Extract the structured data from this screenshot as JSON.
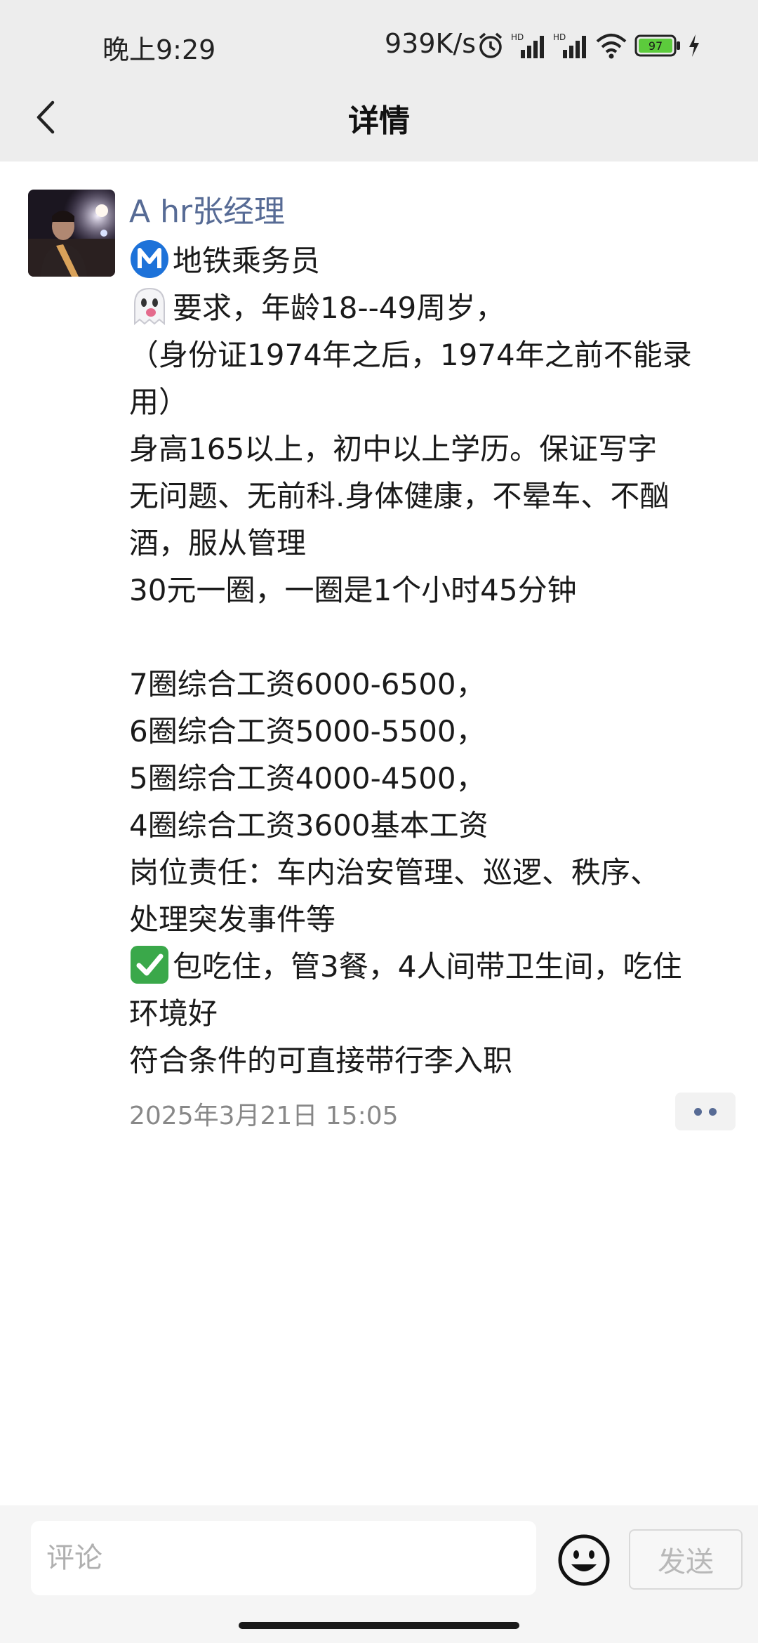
{
  "status_bar": {
    "time": "晚上9:29",
    "net_speed": "939K/s",
    "battery_level": "97",
    "icons": [
      "alarm-icon",
      "hd-signal-icon",
      "hd-signal-icon",
      "wifi-icon",
      "battery-icon",
      "charging-icon"
    ]
  },
  "nav": {
    "title": "详情",
    "back_icon": "back-chevron-icon"
  },
  "post": {
    "author": "A   hr张经理",
    "lines": [
      {
        "emoji": "metro-m-icon",
        "text": "地铁乘务员"
      },
      {
        "emoji": "ghost-icon",
        "text": "要求，年龄18--49周岁，"
      },
      {
        "text": "（身份证1974年之后，1974年之前不能录"
      },
      {
        "text": "用）"
      },
      {
        "text": "身高165以上，初中以上学历。保证写字"
      },
      {
        "text": "无问题、无前科.身体健康，不晕车、不酗"
      },
      {
        "text": "酒，服从管理"
      },
      {
        "text": "30元一圈，一圈是1个小时45分钟"
      },
      {
        "text": ""
      },
      {
        "text": "7圈综合工资6000-6500，"
      },
      {
        "text": "6圈综合工资5000-5500，"
      },
      {
        "text": "5圈综合工资4000-4500，"
      },
      {
        "text": "4圈综合工资3600基本工资"
      },
      {
        "text": "岗位责任：车内治安管理、巡逻、秩序、"
      },
      {
        "text": "处理突发事件等"
      },
      {
        "emoji": "check-mark-icon",
        "text": "包吃住，管3餐，4人间带卫生间，吃住"
      },
      {
        "text": "环境好"
      },
      {
        "text": "符合条件的可直接带行李入职"
      }
    ],
    "timestamp": "2025年3月21日 15:05",
    "more_icon": "more-dots-icon"
  },
  "comment_bar": {
    "placeholder": "评论",
    "emoji_icon": "smiley-icon",
    "send_label": "发送"
  }
}
